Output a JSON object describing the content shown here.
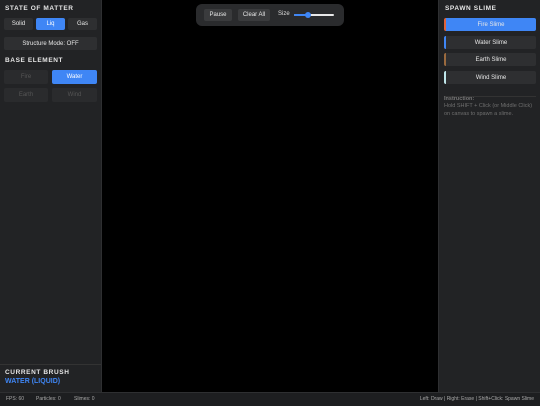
{
  "left": {
    "state_title": "STATE OF MATTER",
    "state_buttons": [
      "Solid",
      "Liq",
      "Gas"
    ],
    "structure_mode": "Structure Mode: OFF",
    "base_title": "BASE ELEMENT",
    "base_buttons": [
      "Fire",
      "Water",
      "Earth",
      "Wind"
    ],
    "brush_title": "CURRENT BRUSH",
    "brush_value": "WATER (LIQUID)"
  },
  "top": {
    "pause": "Pause",
    "clear": "Clear All",
    "size_label": "Size",
    "size_value": 0.35
  },
  "right": {
    "spawn_title": "SPAWN SLIME",
    "slimes": [
      "Fire Slime",
      "Water Slime",
      "Earth Slime",
      "Wind Slime"
    ],
    "instruction_title": "Instruction:",
    "instruction_text": "Hold SHIFT + Click (or Middle Click) on canvas to spawn a slime."
  },
  "status": {
    "fps": "FPS: 60",
    "particles": "Particles: 0",
    "slimes": "Slimes: 0",
    "help": "Left: Draw | Right: Erase | Shift+Click: Spawn Slime"
  },
  "colors": {
    "accent": "#3f86f5",
    "fire": "#e0633a",
    "water": "#3f86f5",
    "earth": "#9a6a3e",
    "wind": "#bfe6ea"
  }
}
